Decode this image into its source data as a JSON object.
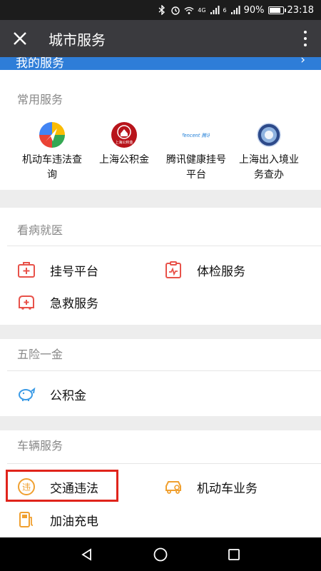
{
  "status_bar": {
    "icons": [
      "bluetooth-icon",
      "alarm-icon",
      "wifi-icon",
      "signal-4g-icon",
      "signal-icon"
    ],
    "network_4g": "4G",
    "network_6": "6",
    "battery_percent": "90%",
    "battery_level": 0.9,
    "time": "23:18"
  },
  "app_bar": {
    "title": "城市服务",
    "close_icon": "close-icon",
    "more_icon": "more-vertical-icon"
  },
  "my_services": {
    "label": "我的服务",
    "arrow": "›"
  },
  "common": {
    "title": "常用服务",
    "items": [
      {
        "label_line1": "机动车违法查",
        "label_line2": "询",
        "icon": "traffic-violation-logo"
      },
      {
        "label_line1": "上海公积金",
        "label_line2": "",
        "icon": "housing-fund-logo",
        "logo_text": "上海公积金"
      },
      {
        "label_line1": "腾讯健康挂号",
        "label_line2": "平台",
        "icon": "tencent-health-logo",
        "logo_text": "Tencent 腾讯"
      },
      {
        "label_line1": "上海出入境业",
        "label_line2": "务查办",
        "icon": "exit-entry-logo"
      }
    ]
  },
  "medical": {
    "title": "看病就医",
    "items": [
      {
        "label": "挂号平台",
        "icon": "medical-kit-icon"
      },
      {
        "label": "体检服务",
        "icon": "checkup-icon"
      },
      {
        "label": "急救服务",
        "icon": "ambulance-icon"
      }
    ]
  },
  "insurance": {
    "title": "五险一金",
    "items": [
      {
        "label": "公积金",
        "icon": "piggy-bank-icon"
      }
    ]
  },
  "vehicle": {
    "title": "车辆服务",
    "items": [
      {
        "label": "交通违法",
        "icon": "traffic-violation-icon",
        "icon_char": "违"
      },
      {
        "label": "机动车业务",
        "icon": "car-service-icon"
      },
      {
        "label": "加油充电",
        "icon": "fuel-pump-icon"
      }
    ]
  },
  "colors": {
    "accent_blue": "#2e7dd8",
    "header_bg": "#3a3a3e",
    "icon_red": "#e8524a",
    "icon_orange": "#f0a030",
    "icon_blue": "#3b9be6",
    "highlight": "#e0241b"
  },
  "nav_bar": {
    "back_icon": "back-triangle-icon",
    "home_icon": "home-circle-icon",
    "recents_icon": "recents-square-icon"
  }
}
